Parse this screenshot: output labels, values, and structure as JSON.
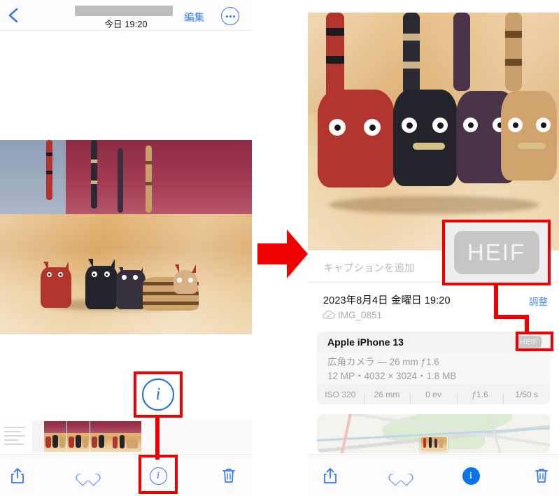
{
  "left_panel": {
    "header": {
      "back_icon": "chevron-left-icon",
      "title_redacted": true,
      "subtitle": "今日 19:20",
      "edit_label": "編集",
      "more_icon": "ellipsis-circle-icon"
    },
    "photo": {
      "alt": "wooden cat figurines on a table"
    },
    "filmstrip": {
      "thumb_count": 5
    },
    "toolbar": {
      "share_icon": "share-icon",
      "favorite_icon": "heart-icon",
      "info_icon": "info-circle-icon",
      "delete_icon": "trash-icon",
      "info_active": false
    }
  },
  "right_panel": {
    "photo": {
      "alt": "wooden cat figurines close-up"
    },
    "caption_placeholder": "キャプションを追加",
    "date": "2023年8月4日 金曜日 19:20",
    "filename": "IMG_0851",
    "cloud_icon": "cloud-check-icon",
    "adjust_label": "調整",
    "device": "Apple iPhone 13",
    "format_badge": "HEIF",
    "lens": "広角カメラ — 26 mm ƒ1.6",
    "specs": "12 MP・4032 × 3024・1.8 MB",
    "exif": [
      "ISO 320",
      "26 mm",
      "0 ev",
      "ƒ1.6",
      "1/50 s"
    ],
    "toolbar": {
      "share_icon": "share-icon",
      "favorite_icon": "heart-icon",
      "info_icon": "info-circle-icon",
      "delete_icon": "trash-icon",
      "info_active": true
    }
  },
  "annotations": {
    "arrow_color": "#ee0000",
    "box_color": "#ee0000",
    "info_callout_glyph": "i",
    "heif_callout_text": "HEIF"
  }
}
